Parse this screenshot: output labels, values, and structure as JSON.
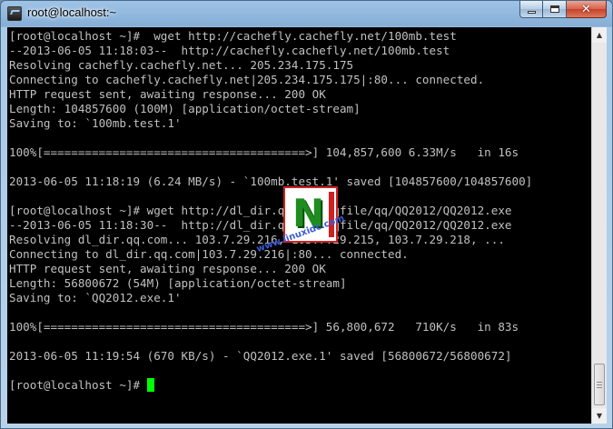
{
  "window": {
    "title": "root@localhost:~",
    "buttons": {
      "minimize": "–",
      "maximize": "□",
      "close": "✕"
    }
  },
  "terminal": {
    "lines": [
      "[root@localhost ~]#  wget http://cachefly.cachefly.net/100mb.test",
      "--2013-06-05 11:18:03--  http://cachefly.cachefly.net/100mb.test",
      "Resolving cachefly.cachefly.net... 205.234.175.175",
      "Connecting to cachefly.cachefly.net|205.234.175.175|:80... connected.",
      "HTTP request sent, awaiting response... 200 OK",
      "Length: 104857600 (100M) [application/octet-stream]",
      "Saving to: `100mb.test.1'",
      "",
      "100%[======================================>] 104,857,600 6.33M/s   in 16s",
      "",
      "2013-06-05 11:18:19 (6.24 MB/s) - `100mb.test.1' saved [104857600/104857600]",
      "",
      "[root@localhost ~]# wget http://dl_dir.qq.com/qqfile/qq/QQ2012/QQ2012.exe",
      "--2013-06-05 11:18:30--  http://dl_dir.qq.com/qqfile/qq/QQ2012/QQ2012.exe",
      "Resolving dl_dir.qq.com... 103.7.29.216, 103.7.29.215, 103.7.29.218, ...",
      "Connecting to dl_dir.qq.com|103.7.29.216|:80... connected.",
      "HTTP request sent, awaiting response... 200 OK",
      "Length: 56800672 (54M) [application/octet-stream]",
      "Saving to: `QQ2012.exe.1'",
      "",
      "100%[======================================>] 56,800,672   710K/s   in 83s",
      "",
      "2013-06-05 11:19:54 (670 KB/s) - `QQ2012.exe.1' saved [56800672/56800672]",
      "",
      "[root@localhost ~]# "
    ],
    "text_color": "#c0c0c0",
    "background": "#000000",
    "cursor_color": "#00ff00"
  },
  "watermark": {
    "letter": "N",
    "site": "www.linuxidc.com"
  },
  "scrollbar": {
    "up": "▲",
    "down": "▼"
  }
}
